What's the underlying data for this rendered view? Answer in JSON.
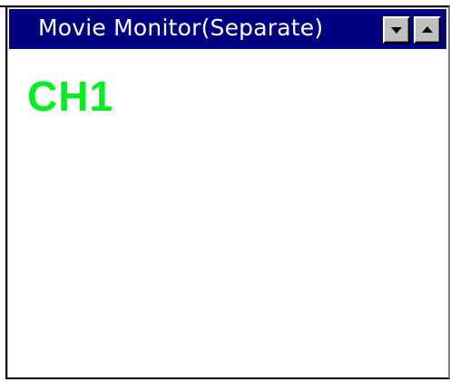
{
  "window": {
    "title": "Movie Monitor(Separate)"
  },
  "titlebar_buttons": {
    "minimize_icon": "triangle-down-icon",
    "maximize_icon": "triangle-up-icon"
  },
  "monitor": {
    "channel_label": "CH1",
    "channel_label_color": "#00ee22"
  },
  "colors": {
    "titlebar": "#000080",
    "title_text": "#ffffff",
    "background": "#ffffff",
    "button_face": "#c0c0c0"
  }
}
